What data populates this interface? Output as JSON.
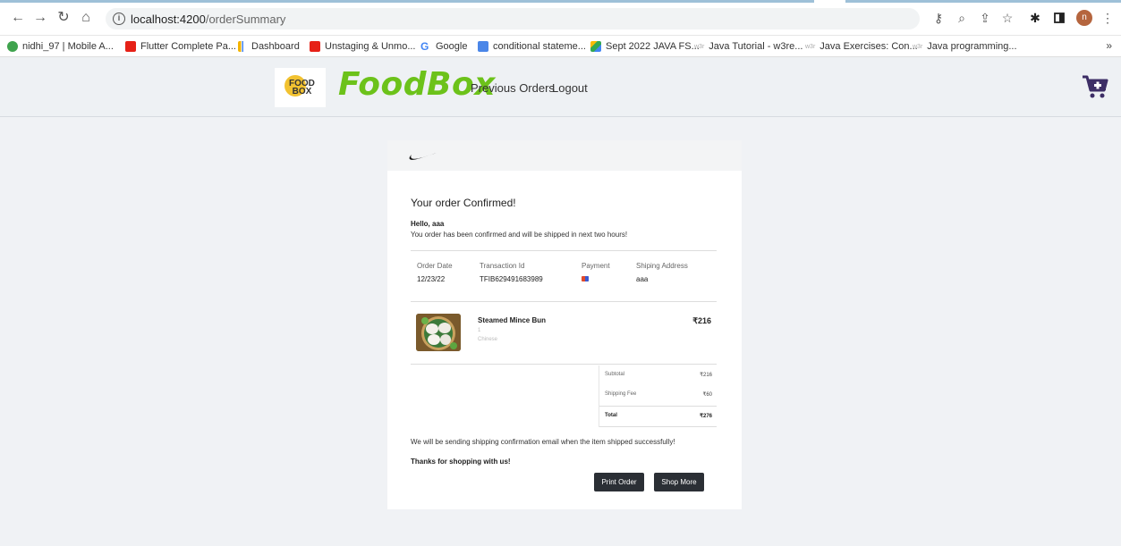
{
  "browser": {
    "url_host": "localhost:4200",
    "url_path": "/orderSummary",
    "profile_initial": "n",
    "bookmarks": [
      {
        "label": "nidhi_97 | Mobile A...",
        "icon_color": "#3fa34d"
      },
      {
        "label": "Flutter Complete Pa...",
        "icon_color": "#e62117"
      },
      {
        "label": "Dashboard",
        "icon_color": "#f4b400"
      },
      {
        "label": "Unstaging & Unmo...",
        "icon_color": "#e62117"
      },
      {
        "label": "Google",
        "icon_color": "#4285f4"
      },
      {
        "label": "conditional stateme...",
        "icon_color": "#4a86e8"
      },
      {
        "label": "Sept 2022 JAVA FS...",
        "icon_color": "#fbbc04"
      },
      {
        "label": "Java Tutorial - w3re...",
        "icon_color": "#ffffff"
      },
      {
        "label": "Java Exercises: Con...",
        "icon_color": "#ffffff"
      },
      {
        "label": "Java programming...",
        "icon_color": "#ffffff"
      }
    ],
    "bookmarks_more": "»",
    "w3r_label": "w3r"
  },
  "header": {
    "logo_text_line1": "FOOD",
    "logo_text_line2": "BOX",
    "brand": "FoodBox",
    "nav": [
      "Previous Orders",
      "Logout"
    ],
    "brand_color": "#6cc21a",
    "cart_color": "#3d2e66"
  },
  "order": {
    "title": "Your order Confirmed!",
    "greeting": "Hello, aaa",
    "message": "You order has been confirmed and will be shipped in next two hours!",
    "info_headers": [
      "Order Date",
      "Transaction Id",
      "Payment",
      "Shiping Address"
    ],
    "info_values": [
      "12/23/22",
      "TFIB629491683989",
      "",
      "aaa"
    ],
    "item": {
      "name": "Steamed Mince Bun",
      "qty": "1",
      "category": "Chinese",
      "price": "₹216"
    },
    "summary": [
      {
        "label": "Subtotal",
        "value": "₹216"
      },
      {
        "label": "Shipping Fee",
        "value": "₹60"
      },
      {
        "label": "Total",
        "value": "₹276"
      }
    ],
    "footer_text": "We will be sending shipping confirmation email when the item shipped successfully!",
    "thanks": "Thanks for shopping with us!",
    "buttons": {
      "print": "Print Order",
      "shop": "Shop More"
    }
  }
}
